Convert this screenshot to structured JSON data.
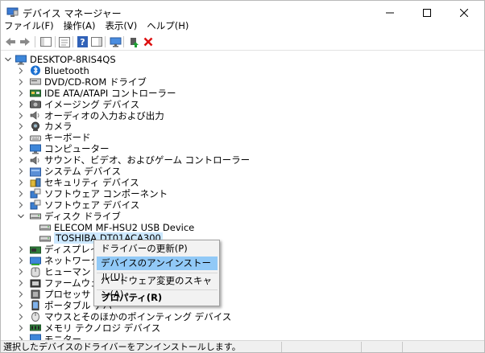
{
  "window": {
    "title": "デバイス マネージャー"
  },
  "menu": [
    "ファイル(F)",
    "操作(A)",
    "表示(V)",
    "ヘルプ(H)"
  ],
  "tree": {
    "root": "DESKTOP-8RIS4QS",
    "items": [
      {
        "label": "Bluetooth",
        "icon": "bluetooth-icon"
      },
      {
        "label": "DVD/CD-ROM ドライブ",
        "icon": "dvd-drive-icon"
      },
      {
        "label": "IDE ATA/ATAPI コントローラー",
        "icon": "ide-controller-icon"
      },
      {
        "label": "イメージング デバイス",
        "icon": "camera-device-icon"
      },
      {
        "label": "オーディオの入力および出力",
        "icon": "speaker-icon"
      },
      {
        "label": "カメラ",
        "icon": "webcam-icon"
      },
      {
        "label": "キーボード",
        "icon": "keyboard-icon"
      },
      {
        "label": "コンピューター",
        "icon": "monitor-icon"
      },
      {
        "label": "サウンド、ビデオ、およびゲーム コントローラー",
        "icon": "speaker-icon"
      },
      {
        "label": "システム デバイス",
        "icon": "system-folder-icon"
      },
      {
        "label": "セキュリティ デバイス",
        "icon": "security-device-icon"
      },
      {
        "label": "ソフトウェア コンポーネント",
        "icon": "component-icon"
      },
      {
        "label": "ソフトウェア デバイス",
        "icon": "component-icon"
      },
      {
        "label": "ディスク ドライブ",
        "icon": "disk-drive-icon",
        "expanded": true
      },
      {
        "label": "ELECOM MF-HSU2 USB Device",
        "icon": "disk-drive-icon",
        "child": true
      },
      {
        "label": "TOSHIBA DT01ACA300",
        "icon": "disk-drive-icon",
        "child": true,
        "selected": true
      },
      {
        "label": "ディスプレイ ア",
        "icon": "display-adapter-icon"
      },
      {
        "label": "ネットワーク ア",
        "icon": "network-adapter-icon"
      },
      {
        "label": "ヒューマン イン",
        "icon": "hid-icon"
      },
      {
        "label": "ファームウェア",
        "icon": "firmware-icon"
      },
      {
        "label": "プロセッサ",
        "icon": "processor-icon"
      },
      {
        "label": "ポータブル デバ",
        "icon": "portable-device-icon"
      },
      {
        "label": "マウスとそのほかのポインティング デバイス",
        "icon": "mouse-icon"
      },
      {
        "label": "メモリ テクノロジ デバイス",
        "icon": "memory-icon"
      },
      {
        "label": "モニター",
        "icon": "monitor-icon"
      }
    ]
  },
  "context_menu": {
    "items": [
      {
        "label": "ドライバーの更新(P)"
      },
      {
        "label": "デバイスのアンインストール(U)",
        "highlighted": true
      },
      {
        "label": "ハードウェア変更のスキャン(A)"
      },
      {
        "label": "プロパティ(R)",
        "bold": true
      }
    ]
  },
  "status": "選択したデバイスのドライバーをアンインストールします。"
}
